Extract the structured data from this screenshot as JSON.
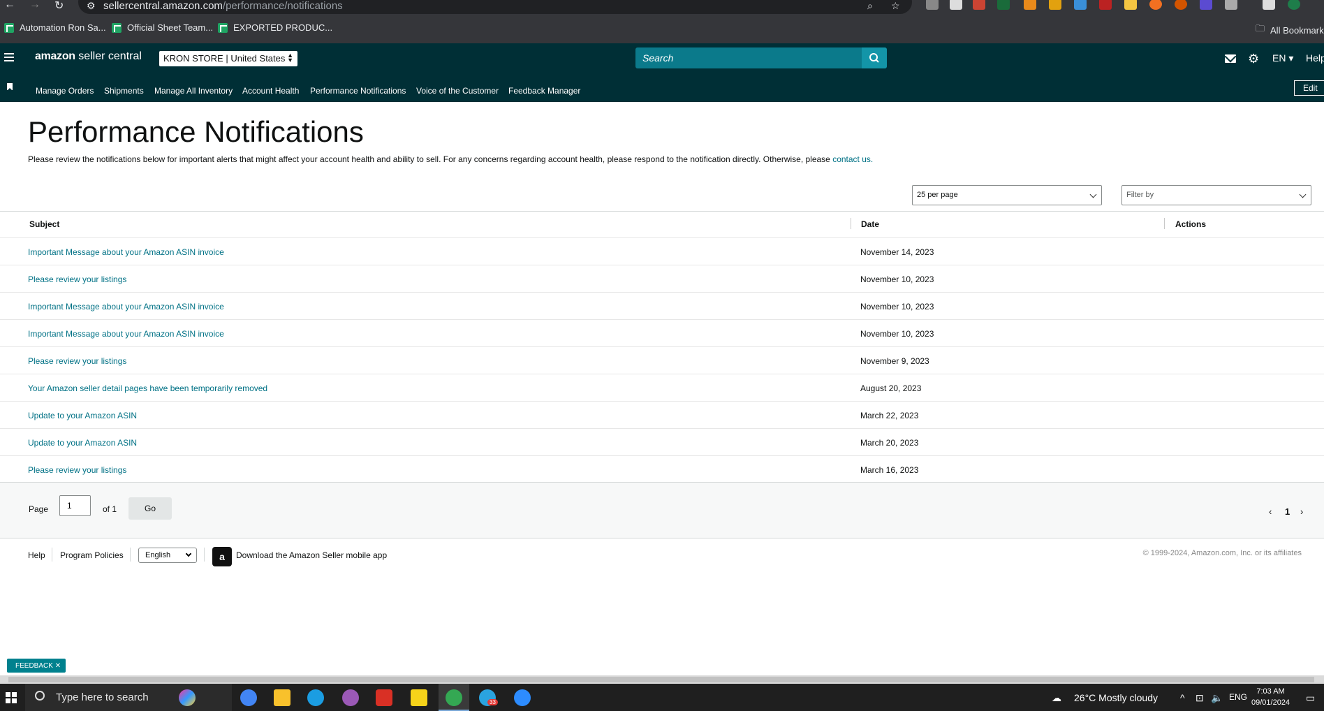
{
  "browser": {
    "url_host": "sellercentral.amazon.com",
    "url_path": "/performance/notifications",
    "bookmarks": [
      "Automation Ron Sa...",
      "Official Sheet Team...",
      "EXPORTED PRODUC..."
    ],
    "all_bookmarks": "All Bookmarks"
  },
  "header": {
    "logo_amazon": "amazon",
    "logo_rest": " seller central",
    "store": "KRON STORE",
    "marketplace": "United States",
    "search_placeholder": "Search",
    "language": "EN",
    "help": "Help"
  },
  "nav": {
    "items": [
      "Manage Orders",
      "Shipments",
      "Manage All Inventory",
      "Account Health",
      "Performance Notifications",
      "Voice of the Customer",
      "Feedback Manager"
    ],
    "edit": "Edit"
  },
  "main": {
    "title": "Performance Notifications",
    "intro": "Please review the notifications below for important alerts that might affect your account health and ability to sell. For any concerns regarding account health, please respond to the notification directly. Otherwise, please ",
    "intro_link": "contact us.",
    "per_page": "25 per page",
    "filter_placeholder": "Filter by",
    "columns": {
      "subject": "Subject",
      "date": "Date",
      "actions": "Actions"
    },
    "rows": [
      {
        "subject": "Important Message about your Amazon ASIN invoice",
        "date": "November 14, 2023"
      },
      {
        "subject": "Please review your listings",
        "date": "November 10, 2023"
      },
      {
        "subject": "Important Message about your Amazon ASIN invoice",
        "date": "November 10, 2023"
      },
      {
        "subject": "Important Message about your Amazon ASIN invoice",
        "date": "November 10, 2023"
      },
      {
        "subject": "Please review your listings",
        "date": "November 9, 2023"
      },
      {
        "subject": "Your Amazon seller detail pages have been temporarily removed",
        "date": "August 20, 2023"
      },
      {
        "subject": "Update to your Amazon ASIN",
        "date": "March 22, 2023"
      },
      {
        "subject": "Update to your Amazon ASIN",
        "date": "March 20, 2023"
      },
      {
        "subject": "Please review your listings",
        "date": "March 16, 2023"
      }
    ]
  },
  "pager": {
    "page_label": "Page",
    "page_value": "1",
    "of_label": "of 1",
    "go": "Go",
    "current": "1"
  },
  "footer": {
    "help": "Help",
    "policies": "Program Policies",
    "language": "English",
    "app_text": "Download the Amazon Seller mobile app",
    "copyright": "© 1999-2024, Amazon.com, Inc. or its affiliates"
  },
  "feedback": "FEEDBACK",
  "taskbar": {
    "search": "Type here to search",
    "weather": "26°C  Mostly cloudy",
    "input_lang": "ENG",
    "time": "7:03 AM",
    "date": "09/01/2024",
    "telegram_badge": "33"
  },
  "colors": {
    "header_bg": "#002f36",
    "link": "#007185",
    "search_bg": "#0b7a8b"
  }
}
